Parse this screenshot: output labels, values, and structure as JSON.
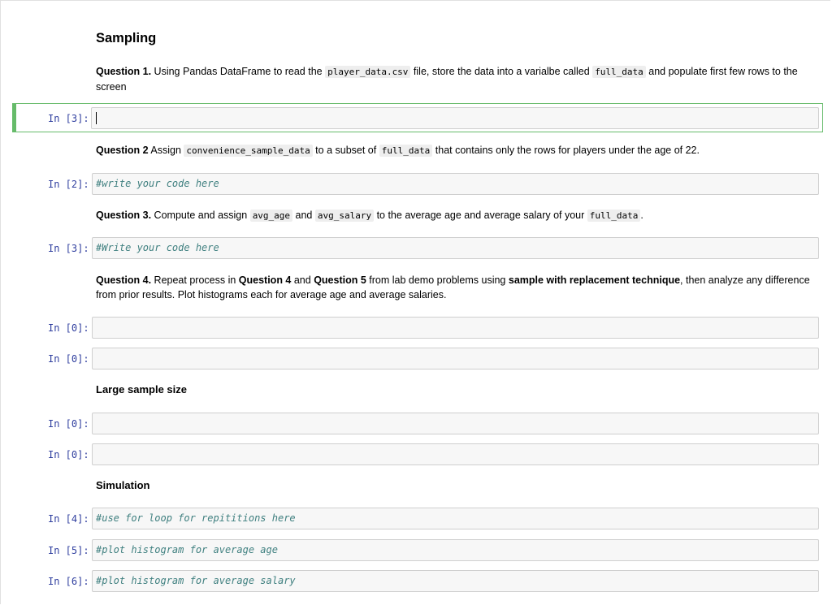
{
  "sections": {
    "sampling_title": "Sampling",
    "large_sample_title": "Large sample size",
    "simulation_title": "Simulation"
  },
  "questions": {
    "q1": {
      "label": "Question 1.",
      "t1": " Using Pandas DataFrame to read the ",
      "c1": "player_data.csv",
      "t2": " file, store the data into a varialbe called ",
      "c2": "full_data",
      "t3": " and populate first few rows to the screen"
    },
    "q2": {
      "label": "Question 2",
      "t1": " Assign ",
      "c1": "convenience_sample_data",
      "t2": " to a subset of ",
      "c2": "full_data",
      "t3": " that contains only the rows for players under the age of 22."
    },
    "q3": {
      "label": "Question 3.",
      "t1": " Compute and assign ",
      "c1": "avg_age",
      "t2": " and ",
      "c2": "avg_salary",
      "t3": " to the average age and average salary of your ",
      "c3": "full_data",
      "t4": "."
    },
    "q4": {
      "label": "Question 4.",
      "t1": " Repeat process in ",
      "b1": "Question 4",
      "t2": " and ",
      "b2": "Question 5",
      "t3": " from lab demo problems using ",
      "b3": "sample with replacement technique",
      "t4": ", then analyze any difference from prior results. Plot histograms each for average age and average salaries."
    }
  },
  "cells": [
    {
      "prompt": "In [3]:",
      "code": ""
    },
    {
      "prompt": "In [2]:",
      "code": "#write your code here"
    },
    {
      "prompt": "In [3]:",
      "code": "#Write your code here"
    },
    {
      "prompt": "In [0]:",
      "code": ""
    },
    {
      "prompt": "In [0]:",
      "code": ""
    },
    {
      "prompt": "In [0]:",
      "code": ""
    },
    {
      "prompt": "In [0]:",
      "code": ""
    },
    {
      "prompt": "In [4]:",
      "code": "#use for loop for repititions here"
    },
    {
      "prompt": "In [5]:",
      "code": "#plot histogram for average age"
    },
    {
      "prompt": "In [6]:",
      "code": "#plot histogram for average salary"
    }
  ]
}
